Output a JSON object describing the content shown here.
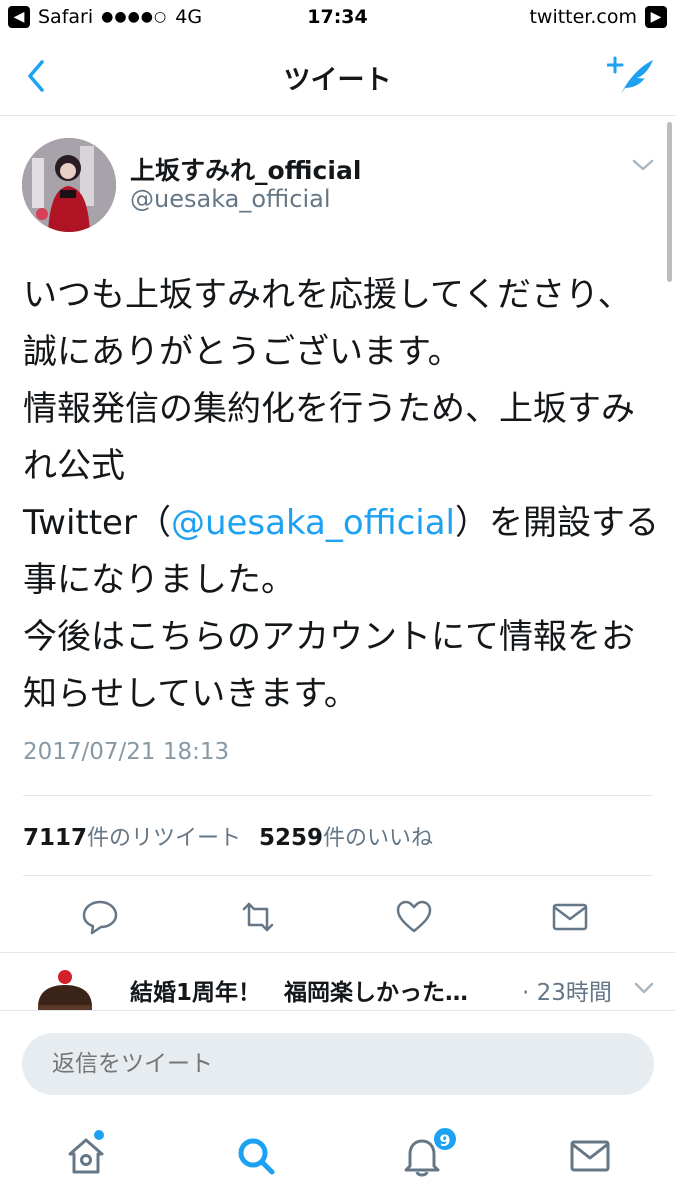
{
  "status_bar": {
    "back_app": "Safari",
    "signal": "●●●●○",
    "network": "4G",
    "time": "17:34",
    "site": "twitter.com"
  },
  "nav": {
    "title": "ツイート",
    "back_icon": "chevron-left-icon",
    "compose_icon": "compose-tweet-icon"
  },
  "tweet": {
    "display_name": "上坂すみれ_official",
    "handle": "@uesaka_official",
    "text_before": "いつも上坂すみれを応援してくださり、誠にありがとうございます。\n情報発信の集約化を行うため、上坂すみれ公式\nTwitter（",
    "mention": "@uesaka_official",
    "text_after": "）を開設する事になりました。\n今後はこちらのアカウントにて情報をお知らせしていきます。",
    "timestamp": "2017/07/21 18:13",
    "retweet_count": "7117",
    "retweet_label": "件のリツイート",
    "like_count": "5259",
    "like_label": "件のいいね"
  },
  "next_tweet": {
    "text": "結婚1周年！　福岡楽しかった…",
    "time": "· 23時間"
  },
  "reply": {
    "placeholder": "返信をツイート"
  },
  "tabs": {
    "notification_badge": "9"
  },
  "colors": {
    "accent": "#1da1f2",
    "text": "#14171a",
    "secondary": "#657786",
    "divider": "#e1e8ed"
  }
}
